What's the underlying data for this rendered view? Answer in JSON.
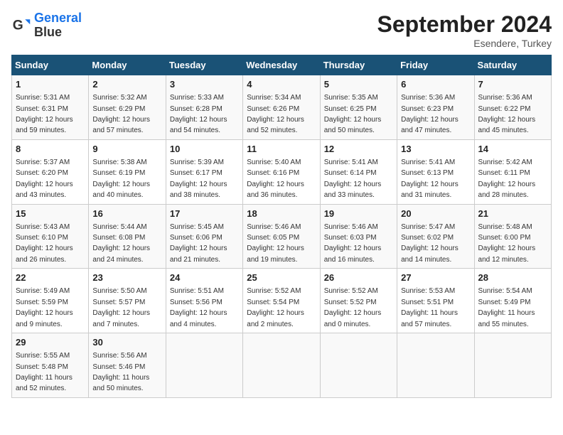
{
  "header": {
    "logo_line1": "General",
    "logo_line2": "Blue",
    "month": "September 2024",
    "location": "Esendere, Turkey"
  },
  "weekdays": [
    "Sunday",
    "Monday",
    "Tuesday",
    "Wednesday",
    "Thursday",
    "Friday",
    "Saturday"
  ],
  "weeks": [
    [
      {
        "day": "1",
        "sunrise": "5:31 AM",
        "sunset": "6:31 PM",
        "daylight": "12 hours and 59 minutes."
      },
      {
        "day": "2",
        "sunrise": "5:32 AM",
        "sunset": "6:29 PM",
        "daylight": "12 hours and 57 minutes."
      },
      {
        "day": "3",
        "sunrise": "5:33 AM",
        "sunset": "6:28 PM",
        "daylight": "12 hours and 54 minutes."
      },
      {
        "day": "4",
        "sunrise": "5:34 AM",
        "sunset": "6:26 PM",
        "daylight": "12 hours and 52 minutes."
      },
      {
        "day": "5",
        "sunrise": "5:35 AM",
        "sunset": "6:25 PM",
        "daylight": "12 hours and 50 minutes."
      },
      {
        "day": "6",
        "sunrise": "5:36 AM",
        "sunset": "6:23 PM",
        "daylight": "12 hours and 47 minutes."
      },
      {
        "day": "7",
        "sunrise": "5:36 AM",
        "sunset": "6:22 PM",
        "daylight": "12 hours and 45 minutes."
      }
    ],
    [
      {
        "day": "8",
        "sunrise": "5:37 AM",
        "sunset": "6:20 PM",
        "daylight": "12 hours and 43 minutes."
      },
      {
        "day": "9",
        "sunrise": "5:38 AM",
        "sunset": "6:19 PM",
        "daylight": "12 hours and 40 minutes."
      },
      {
        "day": "10",
        "sunrise": "5:39 AM",
        "sunset": "6:17 PM",
        "daylight": "12 hours and 38 minutes."
      },
      {
        "day": "11",
        "sunrise": "5:40 AM",
        "sunset": "6:16 PM",
        "daylight": "12 hours and 36 minutes."
      },
      {
        "day": "12",
        "sunrise": "5:41 AM",
        "sunset": "6:14 PM",
        "daylight": "12 hours and 33 minutes."
      },
      {
        "day": "13",
        "sunrise": "5:41 AM",
        "sunset": "6:13 PM",
        "daylight": "12 hours and 31 minutes."
      },
      {
        "day": "14",
        "sunrise": "5:42 AM",
        "sunset": "6:11 PM",
        "daylight": "12 hours and 28 minutes."
      }
    ],
    [
      {
        "day": "15",
        "sunrise": "5:43 AM",
        "sunset": "6:10 PM",
        "daylight": "12 hours and 26 minutes."
      },
      {
        "day": "16",
        "sunrise": "5:44 AM",
        "sunset": "6:08 PM",
        "daylight": "12 hours and 24 minutes."
      },
      {
        "day": "17",
        "sunrise": "5:45 AM",
        "sunset": "6:06 PM",
        "daylight": "12 hours and 21 minutes."
      },
      {
        "day": "18",
        "sunrise": "5:46 AM",
        "sunset": "6:05 PM",
        "daylight": "12 hours and 19 minutes."
      },
      {
        "day": "19",
        "sunrise": "5:46 AM",
        "sunset": "6:03 PM",
        "daylight": "12 hours and 16 minutes."
      },
      {
        "day": "20",
        "sunrise": "5:47 AM",
        "sunset": "6:02 PM",
        "daylight": "12 hours and 14 minutes."
      },
      {
        "day": "21",
        "sunrise": "5:48 AM",
        "sunset": "6:00 PM",
        "daylight": "12 hours and 12 minutes."
      }
    ],
    [
      {
        "day": "22",
        "sunrise": "5:49 AM",
        "sunset": "5:59 PM",
        "daylight": "12 hours and 9 minutes."
      },
      {
        "day": "23",
        "sunrise": "5:50 AM",
        "sunset": "5:57 PM",
        "daylight": "12 hours and 7 minutes."
      },
      {
        "day": "24",
        "sunrise": "5:51 AM",
        "sunset": "5:56 PM",
        "daylight": "12 hours and 4 minutes."
      },
      {
        "day": "25",
        "sunrise": "5:52 AM",
        "sunset": "5:54 PM",
        "daylight": "12 hours and 2 minutes."
      },
      {
        "day": "26",
        "sunrise": "5:52 AM",
        "sunset": "5:52 PM",
        "daylight": "12 hours and 0 minutes."
      },
      {
        "day": "27",
        "sunrise": "5:53 AM",
        "sunset": "5:51 PM",
        "daylight": "11 hours and 57 minutes."
      },
      {
        "day": "28",
        "sunrise": "5:54 AM",
        "sunset": "5:49 PM",
        "daylight": "11 hours and 55 minutes."
      }
    ],
    [
      {
        "day": "29",
        "sunrise": "5:55 AM",
        "sunset": "5:48 PM",
        "daylight": "11 hours and 52 minutes."
      },
      {
        "day": "30",
        "sunrise": "5:56 AM",
        "sunset": "5:46 PM",
        "daylight": "11 hours and 50 minutes."
      },
      null,
      null,
      null,
      null,
      null
    ]
  ]
}
